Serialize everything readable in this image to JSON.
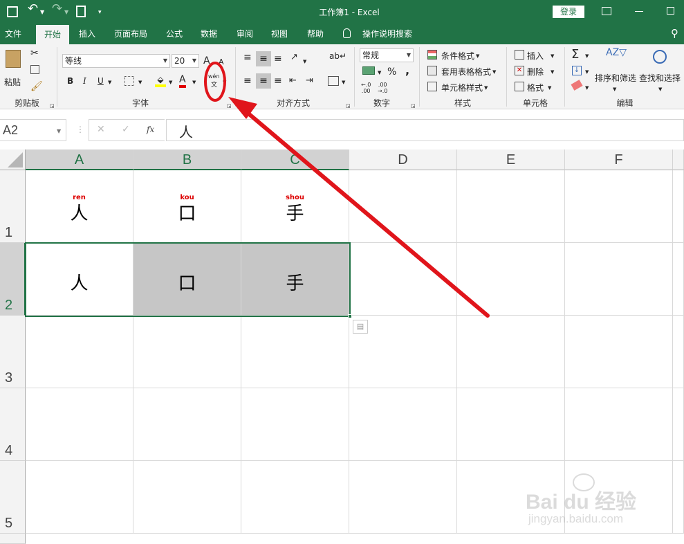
{
  "titlebar": {
    "title": "工作簿1 - Excel",
    "login": "登录"
  },
  "tabs": [
    {
      "label": "文件"
    },
    {
      "label": "开始"
    },
    {
      "label": "插入"
    },
    {
      "label": "页面布局"
    },
    {
      "label": "公式"
    },
    {
      "label": "数据"
    },
    {
      "label": "审阅"
    },
    {
      "label": "视图"
    },
    {
      "label": "帮助"
    },
    {
      "label": "操作说明搜索"
    }
  ],
  "ribbon": {
    "clipboard": {
      "group": "剪贴板",
      "paste": "粘贴"
    },
    "font": {
      "group": "字体",
      "name": "等线",
      "size": "20",
      "bold": "B",
      "italic": "I",
      "underline": "U",
      "grow": "A",
      "shrink": "A",
      "phonetic_top": "wén",
      "phonetic_bottom": "文",
      "font_color": "A"
    },
    "align": {
      "group": "对齐方式"
    },
    "number": {
      "group": "数字",
      "format": "常规",
      "percent": "%",
      "comma": ","
    },
    "styles": {
      "group": "样式",
      "conditional": "条件格式",
      "table": "套用表格格式",
      "cell": "单元格样式"
    },
    "cells": {
      "group": "单元格",
      "insert": "插入",
      "delete": "删除",
      "format": "格式"
    },
    "editing": {
      "group": "编辑",
      "sort": "排序和筛选",
      "find": "查找和选择",
      "sigma": "Σ"
    }
  },
  "formula_bar": {
    "name_box": "A2",
    "content": "人",
    "fx": "fx"
  },
  "columns": [
    "A",
    "B",
    "C",
    "D",
    "E",
    "F"
  ],
  "rows": [
    "1",
    "2",
    "3",
    "4",
    "5"
  ],
  "cells": {
    "row1": [
      {
        "pinyin": "ren",
        "char": "人"
      },
      {
        "pinyin": "kou",
        "char": "口"
      },
      {
        "pinyin": "shou",
        "char": "手"
      }
    ],
    "row2": [
      {
        "char": "人"
      },
      {
        "char": "口"
      },
      {
        "char": "手"
      }
    ]
  },
  "watermark": {
    "brand": "Bai du 经验",
    "url": "jingyan.baidu.com"
  },
  "colors": {
    "excel_green": "#217346",
    "annotation_red": "#e0151b",
    "selection_gray": "#c6c6c6"
  }
}
